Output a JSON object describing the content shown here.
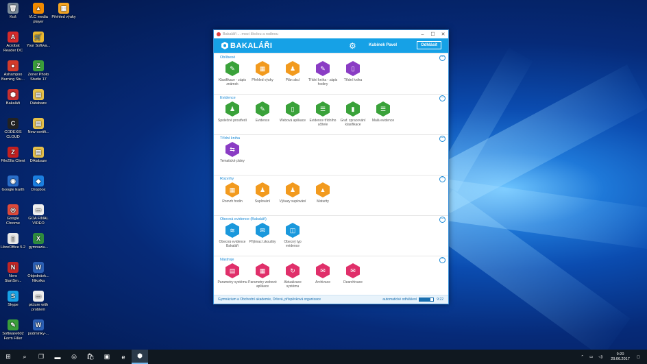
{
  "desktop_icons": [
    {
      "label": "Koš",
      "color": "#7a8a99",
      "glyph": "🗑"
    },
    {
      "label": "VLC media player",
      "color": "#f08a00",
      "glyph": "▲"
    },
    {
      "label": "Přehled výuky",
      "color": "#f5a623",
      "glyph": "▦"
    },
    {
      "label": "Acrobat Reader DC",
      "color": "#d62b2b",
      "glyph": "A"
    },
    {
      "label": "Your Softwa...",
      "color": "#e9b730",
      "glyph": "🛒"
    },
    {
      "label": "Ashampoo Burning Stu...",
      "color": "#d23b2b",
      "glyph": "●"
    },
    {
      "label": "Zoner Photo Studio 17",
      "color": "#3a9e3a",
      "glyph": "Z"
    },
    {
      "label": "Bakaláři",
      "color": "#c83030",
      "glyph": "⬢"
    },
    {
      "label": "Dátabaze",
      "color": "#e6c04a",
      "glyph": "▤"
    },
    {
      "label": "CODEXIS CLOUD",
      "color": "#222",
      "glyph": "C"
    },
    {
      "label": "New-certifi...",
      "color": "#e6c04a",
      "glyph": "▤"
    },
    {
      "label": "FileZilla Client",
      "color": "#c42020",
      "glyph": "Z"
    },
    {
      "label": "DAtabaze",
      "color": "#e6c04a",
      "glyph": "▤"
    },
    {
      "label": "Google Earth",
      "color": "#2a6ec9",
      "glyph": "◉"
    },
    {
      "label": "Dropbox",
      "color": "#1b7fe0",
      "glyph": "◆"
    },
    {
      "label": "Google Chrome",
      "color": "#de4a3a",
      "glyph": "◎"
    },
    {
      "label": "GOA FINAL VIDEO",
      "color": "#eee",
      "glyph": "▭"
    },
    {
      "label": "LibreOffice 5.2",
      "color": "#e8e8e8",
      "glyph": "▯"
    },
    {
      "label": "gymnaziu...",
      "color": "#2e8b3e",
      "glyph": "X"
    },
    {
      "label": "Nero StartSm...",
      "color": "#c02626",
      "glyph": "N"
    },
    {
      "label": "Objednávk... Nikolka",
      "color": "#2b5fb5",
      "glyph": "W"
    },
    {
      "label": "Skype",
      "color": "#18a2e6",
      "glyph": "S"
    },
    {
      "label": "picture with problem",
      "color": "#eee",
      "glyph": "▭"
    },
    {
      "label": "Software602 Form Filler",
      "color": "#3a9e3a",
      "glyph": "✎"
    },
    {
      "label": "podmínky-...",
      "color": "#2b5fb5",
      "glyph": "W"
    }
  ],
  "window": {
    "title": "Bakaláři ... mezi školou a rodinou",
    "brand": "BAKALÁŘI",
    "user": "Kubínek Pavel",
    "logout_label": "Odhlásit",
    "sections": [
      {
        "title": "Oblíbené",
        "tiles": [
          {
            "label": "Klasifikace - zápis známek",
            "color": "#3aa23a",
            "icon": "pencil-icon",
            "glyph": "✎"
          },
          {
            "label": "Přehled výuky",
            "color": "#f29a1e",
            "icon": "grid-icon",
            "glyph": "▦"
          },
          {
            "label": "Plán akcí",
            "color": "#f29a1e",
            "icon": "person-icon",
            "glyph": "♟"
          },
          {
            "label": "Třídní kniha - zápis hodiny",
            "color": "#8a3cc4",
            "icon": "book-pencil-icon",
            "glyph": "✎"
          },
          {
            "label": "Třídní kniha",
            "color": "#8a3cc4",
            "icon": "book-icon",
            "glyph": "▯"
          }
        ]
      },
      {
        "title": "Evidence",
        "tiles": [
          {
            "label": "Společné prostředí",
            "color": "#3aa23a",
            "icon": "people-icon",
            "glyph": "♟"
          },
          {
            "label": "Evidence",
            "color": "#3aa23a",
            "icon": "pencil-icon",
            "glyph": "✎"
          },
          {
            "label": "Webová aplikace",
            "color": "#3aa23a",
            "icon": "book-icon",
            "glyph": "▯"
          },
          {
            "label": "Evidence třídního učitele",
            "color": "#3aa23a",
            "icon": "list-icon",
            "glyph": "☰"
          },
          {
            "label": "Graf. zpracování klasifikace",
            "color": "#3aa23a",
            "icon": "bar-chart-icon",
            "glyph": "▮"
          },
          {
            "label": "Malá evidence",
            "color": "#3aa23a",
            "icon": "notes-icon",
            "glyph": "☰"
          }
        ]
      },
      {
        "title": "Třídní kniha",
        "tiles": [
          {
            "label": "Tematické plány",
            "color": "#8a3cc4",
            "icon": "signpost-icon",
            "glyph": "⇆"
          }
        ]
      },
      {
        "title": "Rozvrhy",
        "tiles": [
          {
            "label": "Rozvrh hodin",
            "color": "#f29a1e",
            "icon": "calendar-icon",
            "glyph": "▦"
          },
          {
            "label": "Suplování",
            "color": "#f29a1e",
            "icon": "person-swap-icon",
            "glyph": "♟"
          },
          {
            "label": "Výkazy suplování",
            "color": "#f29a1e",
            "icon": "person-report-icon",
            "glyph": "♟"
          },
          {
            "label": "Maturity",
            "color": "#f29a1e",
            "icon": "graduation-cap-icon",
            "glyph": "▲"
          }
        ]
      },
      {
        "title": "Obecná evidence (Bakaláři)",
        "tiles": [
          {
            "label": "Obecná evidence Bakaláři",
            "color": "#1a98dc",
            "icon": "layers-icon",
            "glyph": "≋"
          },
          {
            "label": "Přijímací zkoušky",
            "color": "#1a98dc",
            "icon": "inbox-icon",
            "glyph": "✉"
          },
          {
            "label": "Obecný typ evidence",
            "color": "#1a98dc",
            "icon": "database-icon",
            "glyph": "◫"
          }
        ]
      },
      {
        "title": "Nástroje",
        "tiles": [
          {
            "label": "Parametry systému",
            "color": "#e02f6a",
            "icon": "document-icon",
            "glyph": "▤"
          },
          {
            "label": "Parametry webové aplikace",
            "color": "#e02f6a",
            "icon": "calendar-grid-icon",
            "glyph": "▦"
          },
          {
            "label": "Aktualizace systému",
            "color": "#e02f6a",
            "icon": "refresh-icon",
            "glyph": "↻"
          },
          {
            "label": "Archivace",
            "color": "#e02f6a",
            "icon": "archive-in-icon",
            "glyph": "✉"
          },
          {
            "label": "Dearchivace",
            "color": "#e02f6a",
            "icon": "archive-out-icon",
            "glyph": "✉"
          }
        ]
      }
    ],
    "status": {
      "organization": "Gymnázium a Obchodní akademie, Orlová, příspěvková organizace",
      "auto_logout": "automatické odhlášení",
      "time": "9:22",
      "progress": 0.8
    }
  },
  "taskbar": {
    "items": [
      {
        "name": "start-button",
        "glyph": "⊞"
      },
      {
        "name": "search-icon",
        "glyph": "⌕"
      },
      {
        "name": "task-view-icon",
        "glyph": "❐"
      },
      {
        "name": "file-explorer-icon",
        "glyph": "▬"
      },
      {
        "name": "chrome-icon",
        "glyph": "◎"
      },
      {
        "name": "store-icon",
        "glyph": "🛍"
      },
      {
        "name": "remote-desktop-icon",
        "glyph": "▣"
      },
      {
        "name": "edge-icon",
        "glyph": "e"
      },
      {
        "name": "bakalari-taskbar-icon",
        "glyph": "⬢"
      }
    ],
    "clock_time": "9:20",
    "clock_date": "29.06.2017"
  }
}
